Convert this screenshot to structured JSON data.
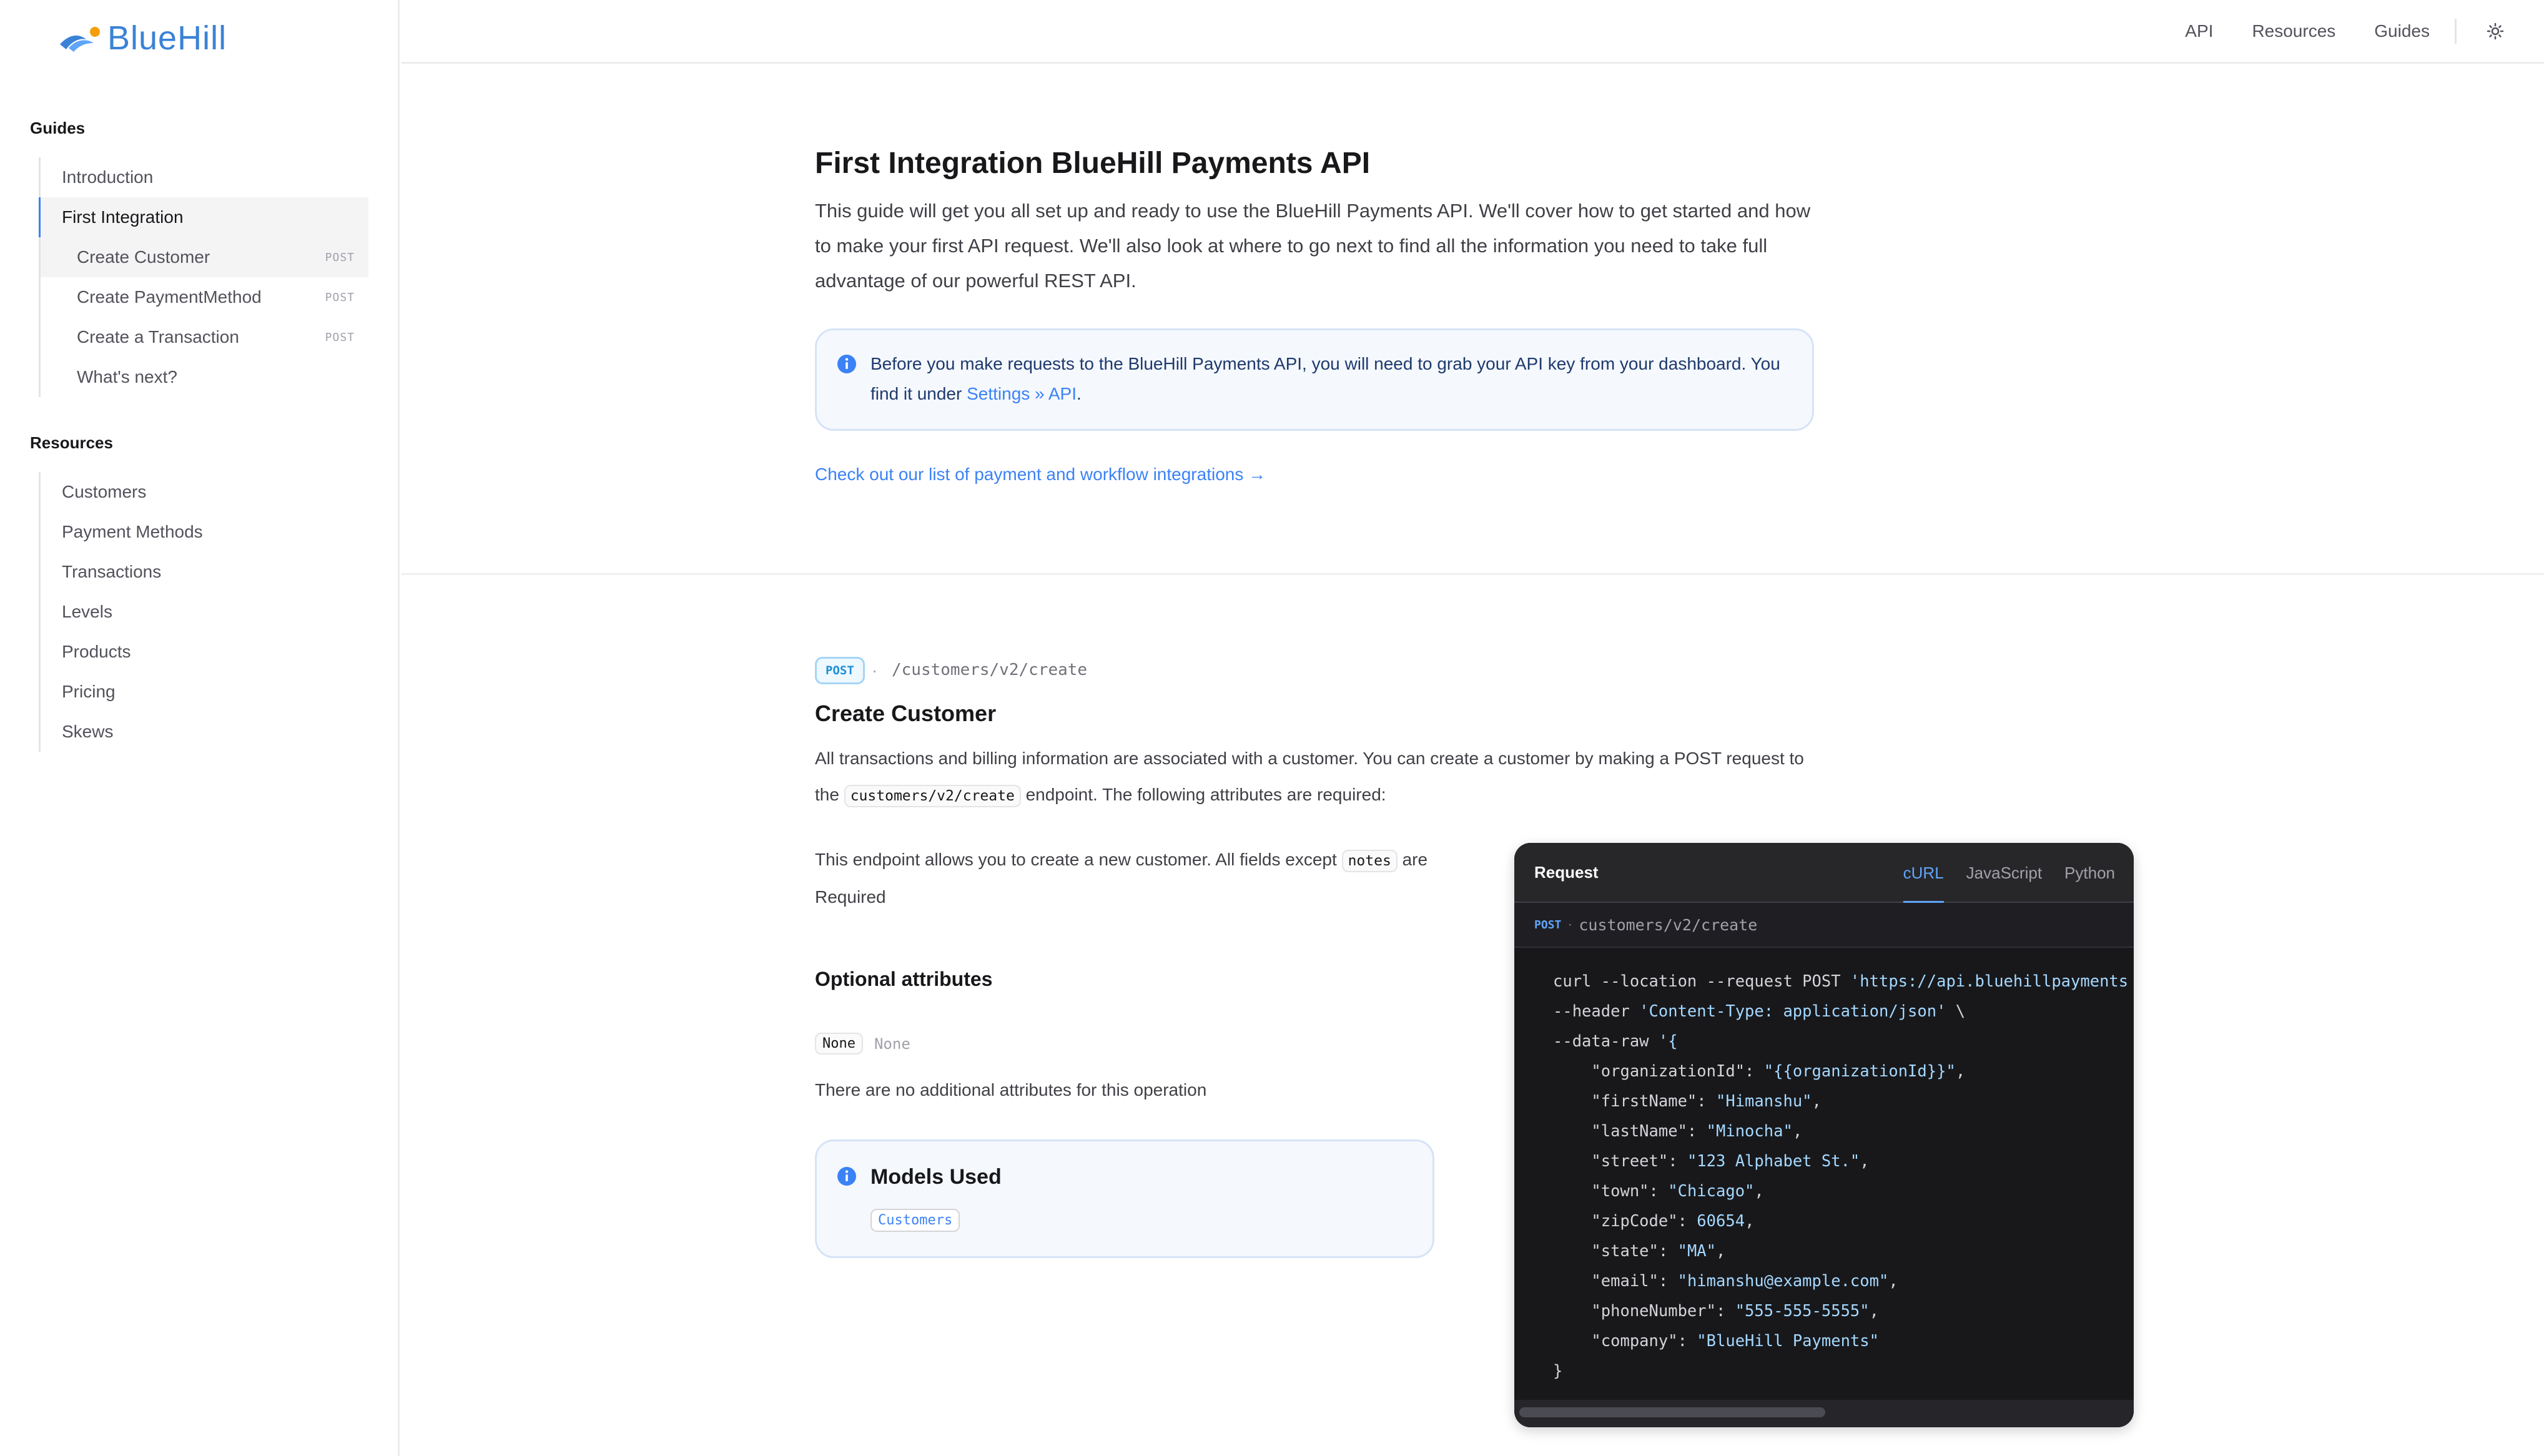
{
  "brand": {
    "name": "BlueHill",
    "color": "#3b82d6"
  },
  "top_nav": {
    "items": [
      "API",
      "Resources",
      "Guides"
    ],
    "theme_icon": "sun-icon"
  },
  "sidebar": {
    "guides_heading": "Guides",
    "guides": [
      {
        "label": "Introduction"
      },
      {
        "label": "First Integration"
      },
      {
        "label": "Create Customer",
        "badge": "POST"
      },
      {
        "label": "Create PaymentMethod",
        "badge": "POST"
      },
      {
        "label": "Create a Transaction",
        "badge": "POST"
      },
      {
        "label": "What's next?"
      }
    ],
    "resources_heading": "Resources",
    "resources": [
      {
        "label": "Customers"
      },
      {
        "label": "Payment Methods"
      },
      {
        "label": "Transactions"
      },
      {
        "label": "Levels"
      },
      {
        "label": "Products"
      },
      {
        "label": "Pricing"
      },
      {
        "label": "Skews"
      }
    ]
  },
  "intro": {
    "title": "First Integration BlueHill Payments API",
    "text": "This guide will get you all set up and ready to use the BlueHill Payments API. We'll cover how to get started and how to make your first API request. We'll also look at where to go next to find all the information you need to take full advantage of our powerful REST API.",
    "callout_text": "Before you make requests to the BlueHill Payments API, you will need to grab your API key from your dashboard. You find it under ",
    "callout_link": "Settings » API",
    "callout_end": ".",
    "integrations_link": "Check out our list of payment and workflow integrations →"
  },
  "endpoint": {
    "method": "POST",
    "separator": "·",
    "path": "/customers/v2/create",
    "title": "Create Customer",
    "desc_before": "All transactions and billing information are associated with a customer. You can create a customer by making a POST request to the ",
    "desc_code": "customers/v2/create",
    "desc_after": " endpoint. The following attributes are required:",
    "fields_before": "This endpoint allows you to create a new customer. All fields except ",
    "fields_code": "notes",
    "fields_after": " are Required",
    "optional_title": "Optional attributes",
    "optional_name": "None",
    "optional_type": "None",
    "no_attrs": "There are no additional attributes for this operation",
    "models_title": "Models Used",
    "models_tag": "Customers"
  },
  "request": {
    "title": "Request",
    "tabs": [
      "cURL",
      "JavaScript",
      "Python"
    ],
    "active_tab": "cURL",
    "method": "POST",
    "separator": "·",
    "path": "customers/v2/create",
    "code_lines": [
      {
        "plain": "curl --location --request POST ",
        "str": "'https://api.bluehillpayments"
      },
      {
        "plain": "--header ",
        "str": "'Content-Type: application/json'",
        "tail": " \\"
      },
      {
        "plain": "--data-raw ",
        "str": "'{"
      },
      {
        "plain": "    \"organizationId\": ",
        "str": "\"{{organizationId}}\"",
        "tail": ","
      },
      {
        "plain": "    \"firstName\": ",
        "str": "\"Himanshu\"",
        "tail": ","
      },
      {
        "plain": "    \"lastName\": ",
        "str": "\"Minocha\"",
        "tail": ","
      },
      {
        "plain": "    \"street\": ",
        "str": "\"123 Alphabet St.\"",
        "tail": ","
      },
      {
        "plain": "    \"town\": ",
        "str": "\"Chicago\"",
        "tail": ","
      },
      {
        "plain": "    \"zipCode\": ",
        "str": "60654",
        "tail": ","
      },
      {
        "plain": "    \"state\": ",
        "str": "\"MA\"",
        "tail": ","
      },
      {
        "plain": "    \"email\": ",
        "str": "\"himanshu@example.com\"",
        "tail": ","
      },
      {
        "plain": "    \"phoneNumber\": ",
        "str": "\"555-555-5555\"",
        "tail": ","
      },
      {
        "plain": "    \"company\": ",
        "str": "\"BlueHill Payments\""
      },
      {
        "plain": "}"
      }
    ]
  }
}
